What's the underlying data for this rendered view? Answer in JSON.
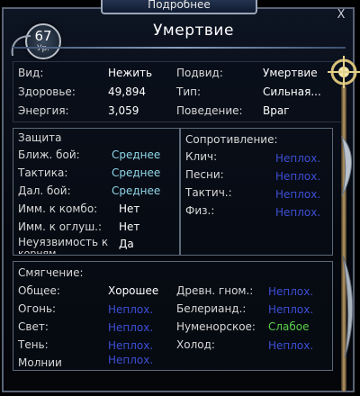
{
  "window": {
    "tab_title": "Подробнее",
    "close": "X"
  },
  "header": {
    "level": "67",
    "level_label": "Ур.",
    "name": "Умертвие"
  },
  "info": {
    "left": [
      {
        "label": "Вид:",
        "value": "Нежить"
      },
      {
        "label": "Здоровье:",
        "value": "49,894"
      },
      {
        "label": "Энергия:",
        "value": "3,059"
      }
    ],
    "right": [
      {
        "label": "Подвид:",
        "value": "Умертвие"
      },
      {
        "label": "Тип:",
        "value": "Сильная..."
      },
      {
        "label": "Поведение:",
        "value": "Враг"
      }
    ]
  },
  "defense": {
    "title": "Защита",
    "rows": [
      {
        "label": "Ближ. бой:",
        "value": "Среднее"
      },
      {
        "label": "Тактика:",
        "value": "Среднее"
      },
      {
        "label": "Дал. бой:",
        "value": "Среднее"
      },
      {
        "label": "Имм. к комбо:",
        "value": "Нет"
      },
      {
        "label": "Имм. к оглуш.:",
        "value": "Нет"
      },
      {
        "label": "Неуязвимость к",
        "label2": "корням",
        "value": "Да"
      }
    ]
  },
  "resistance": {
    "title": "Сопротивление:",
    "rows": [
      {
        "label": "Клич:",
        "value": "Неплох."
      },
      {
        "label": "Песни:",
        "value": "Неплох."
      },
      {
        "label": "Тактич.:",
        "value": "Неплох."
      },
      {
        "label": "Физ.:",
        "value": "Неплох."
      }
    ]
  },
  "mitigation": {
    "title": "Смягчение:",
    "left": [
      {
        "label": "Общее:",
        "value": "Хорошее"
      },
      {
        "label": "Огонь:",
        "value": "Неплох."
      },
      {
        "label": "Свет:",
        "value": "Неплох."
      },
      {
        "label": "Тень:",
        "value": "Неплох."
      },
      {
        "label": "Молнии",
        "value": "Неплох."
      }
    ],
    "right": [
      {
        "label": "Древн. гном.:",
        "value": "Неплох."
      },
      {
        "label": "Белерианд.:",
        "value": "Неплох."
      },
      {
        "label": "Нуменорское:",
        "value": "Слабое"
      },
      {
        "label": "Холод:",
        "value": "Неплох."
      }
    ]
  }
}
